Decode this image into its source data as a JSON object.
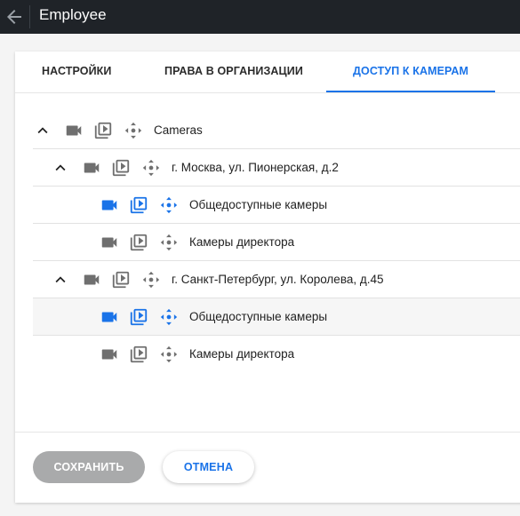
{
  "header": {
    "title": "Employee"
  },
  "tabs": [
    {
      "label": "НАСТРОЙКИ"
    },
    {
      "label": "ПРАВА В ОРГАНИЗАЦИИ"
    },
    {
      "label": "ДОСТУП К КАМЕРАМ"
    }
  ],
  "tree": {
    "root": {
      "label": "Cameras"
    },
    "groups": [
      {
        "label": "г. Москва, ул. Пионерская, д.2",
        "children": [
          {
            "label": "Общедоступные камеры",
            "active": true
          },
          {
            "label": "Камеры директора",
            "active": false
          }
        ]
      },
      {
        "label": "г. Санкт-Петербург, ул. Королева, д.45",
        "children": [
          {
            "label": "Общедоступные камеры",
            "active": true
          },
          {
            "label": "Камеры директора",
            "active": false
          }
        ]
      }
    ]
  },
  "buttons": {
    "save": "СОХРАНИТЬ",
    "cancel": "ОТМЕНА"
  },
  "colors": {
    "accent": "#1a73e8",
    "inactive_icon": "#6f6f6f",
    "topbar": "#1f2328",
    "disabled_button": "#a9aaab"
  },
  "icons": [
    "back-arrow-icon",
    "chevron-up-icon",
    "videocam-icon",
    "playback-icon",
    "ptz-move-icon"
  ]
}
